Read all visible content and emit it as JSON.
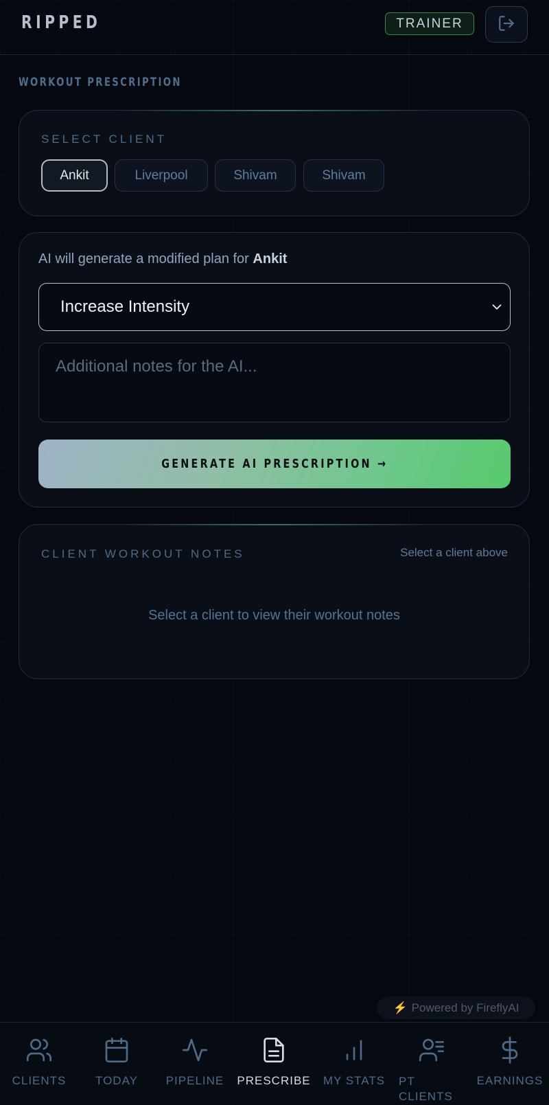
{
  "header": {
    "logo": "RIPPED",
    "role_badge": "TRAINER"
  },
  "page": {
    "section_title": "WORKOUT PRESCRIPTION"
  },
  "client_select": {
    "label": "SELECT CLIENT",
    "clients": [
      "Ankit",
      "Liverpool",
      "Shivam",
      "Shivam"
    ],
    "selected": "Ankit"
  },
  "ai_panel": {
    "intro_prefix": "AI will generate a modified plan for",
    "client_name": "Ankit",
    "mode_value": "Increase Intensity",
    "notes_placeholder": "Additional notes for the AI...",
    "generate_label": "GENERATE AI PRESCRIPTION →"
  },
  "workout_notes": {
    "label": "CLIENT WORKOUT NOTES",
    "hint": "Select a client above",
    "empty_message": "Select a client to view their workout notes"
  },
  "powered_by": {
    "bolt": "⚡",
    "text": "Powered by FireflyAI"
  },
  "nav": {
    "active": "PRESCRIBE",
    "items": [
      {
        "label": "CLIENTS",
        "icon": "users-icon"
      },
      {
        "label": "TODAY",
        "icon": "calendar-icon"
      },
      {
        "label": "PIPELINE",
        "icon": "activity-icon"
      },
      {
        "label": "PRESCRIBE",
        "icon": "document-icon"
      },
      {
        "label": "MY STATS",
        "icon": "bar-chart-icon"
      },
      {
        "label": "PT CLIENTS",
        "icon": "user-list-icon"
      },
      {
        "label": "EARNINGS",
        "icon": "dollar-icon"
      }
    ]
  },
  "colors": {
    "background": "#05080f",
    "accent_green": "#57c96c",
    "muted_blue": "#4d6b8a"
  }
}
